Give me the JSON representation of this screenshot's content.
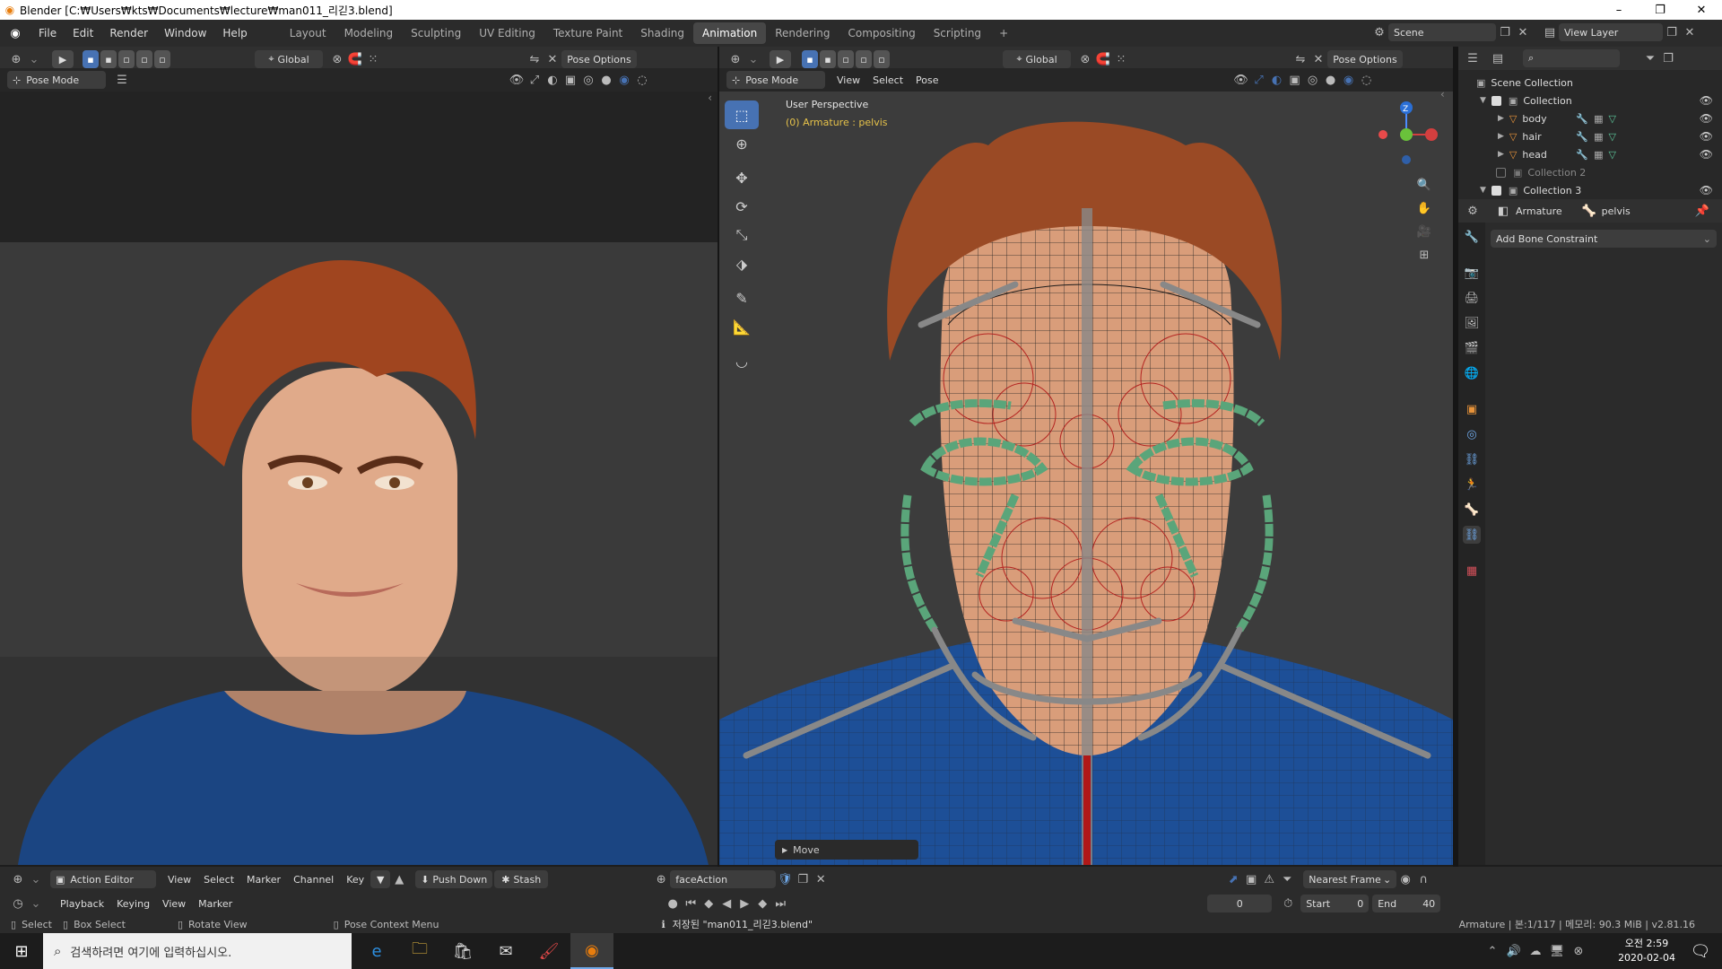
{
  "window": {
    "title": "Blender [C:₩Users₩kts₩Documents₩lecture₩man011_리긷3.blend]",
    "min": "–",
    "max": "❐",
    "close": "✕"
  },
  "menu": [
    "File",
    "Edit",
    "Render",
    "Window",
    "Help"
  ],
  "workspaces": [
    "Layout",
    "Modeling",
    "Sculpting",
    "UV Editing",
    "Texture Paint",
    "Shading",
    "Animation",
    "Rendering",
    "Compositing",
    "Scripting",
    "+"
  ],
  "active_workspace": "Animation",
  "scene": {
    "name": "Scene",
    "view_layer": "View Layer"
  },
  "left_view": {
    "transform": "Global",
    "pose_options": "Pose Options",
    "mode": "Pose Mode"
  },
  "right_view": {
    "transform": "Global",
    "pose_options": "Pose Options",
    "mode": "Pose Mode",
    "menus": [
      "View",
      "Select",
      "Pose"
    ],
    "perspective": "User Perspective",
    "object_info": "(0) Armature : pelvis",
    "last_op": "Move",
    "gizmo": {
      "z": "Z"
    }
  },
  "outliner": {
    "root": "Scene Collection",
    "items": [
      {
        "label": "Collection",
        "level": 1,
        "checked": true,
        "visible": true
      },
      {
        "label": "body",
        "level": 2,
        "checked": false,
        "visible": true
      },
      {
        "label": "hair",
        "level": 2,
        "checked": false,
        "visible": true
      },
      {
        "label": "head",
        "level": 2,
        "checked": false,
        "visible": true
      },
      {
        "label": "Collection 2",
        "level": 1,
        "checked": false,
        "visible": false
      },
      {
        "label": "Collection 3",
        "level": 1,
        "checked": true,
        "visible": true
      }
    ]
  },
  "properties": {
    "object": "Armature",
    "bone": "pelvis",
    "add_constraint": "Add Bone Constraint"
  },
  "action_editor": {
    "mode": "Action Editor",
    "menus": [
      "View",
      "Select",
      "Marker",
      "Channel",
      "Key"
    ],
    "push_down": "Push Down",
    "stash": "Stash",
    "action": "faceAction",
    "snap": "Nearest Frame"
  },
  "timeline": {
    "menus": [
      "Playback",
      "Keying",
      "View",
      "Marker"
    ],
    "current_frame": "0",
    "start_label": "Start",
    "start": "0",
    "end_label": "End",
    "end": "40"
  },
  "status": {
    "select": "Select",
    "box_select": "Box Select",
    "rotate_view": "Rotate View",
    "pose_context": "Pose Context Menu",
    "saved": "저장된 \"man011_리긷3.blend\"",
    "info": "Armature | 본:1/117 | 메모리: 90.3 MiB | v2.81.16"
  },
  "taskbar": {
    "search_placeholder": "검색하려면 여기에 입력하십시오.",
    "time": "오전 2:59",
    "date": "2020-02-04"
  },
  "colors": {
    "accent": "#4772b3",
    "orange": "#e87d0d",
    "bone_green": "#4c9a6a",
    "rig_red": "#b01818"
  }
}
